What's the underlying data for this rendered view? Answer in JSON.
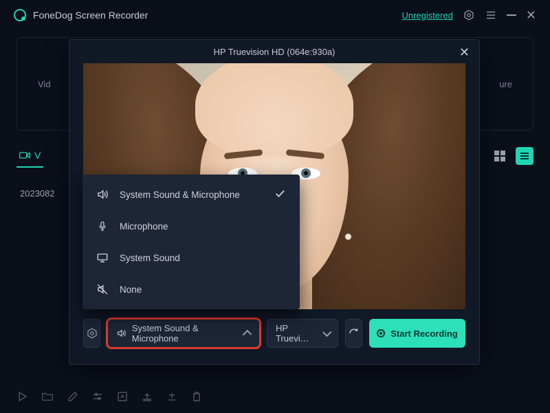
{
  "app": {
    "title": "FoneDog Screen Recorder",
    "unregistered_label": "Unregistered"
  },
  "background": {
    "panel_left": "Vid",
    "panel_right": "ure",
    "tab_video_label": "V",
    "file_date": "2023082"
  },
  "modal": {
    "title": "HP Truevision HD (064e:930a)",
    "audio_selector_label": "System Sound & Microphone",
    "device_selector_label": "HP Truevi…",
    "start_label": "Start Recording"
  },
  "audio_options": [
    {
      "label": "System Sound & Microphone",
      "icon": "speaker-icon",
      "selected": true
    },
    {
      "label": "Microphone",
      "icon": "mic-icon",
      "selected": false
    },
    {
      "label": "System Sound",
      "icon": "monitor-icon",
      "selected": false
    },
    {
      "label": "None",
      "icon": "mute-icon",
      "selected": false
    }
  ]
}
